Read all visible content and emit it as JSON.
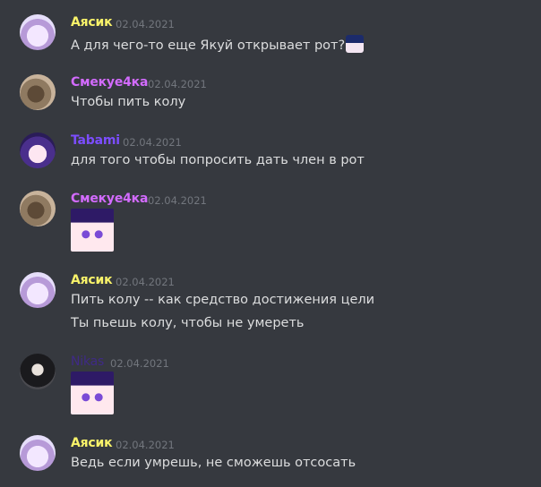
{
  "messages": [
    {
      "author": "Аясик",
      "author_color": "#f9f36a",
      "time": "02.04.2021",
      "avatar": "ayasik-avatar",
      "lines": [
        "А для чего-то еще Якуй открывает рот?"
      ],
      "emoji": "anime-face-emoji"
    },
    {
      "author": "Смекуе4ка",
      "author_color": "#d36bff",
      "time": "02.04.2021",
      "avatar": "smekue-avatar",
      "lines": [
        "Чтобы пить колу"
      ]
    },
    {
      "author": "Tabami",
      "author_color": "#7c4dff",
      "time": "02.04.2021",
      "avatar": "tabami-avatar",
      "lines": [
        "для того чтобы попросить дать член в рот"
      ]
    },
    {
      "author": "Смекуе4ка",
      "author_color": "#d36bff",
      "time": "02.04.2021",
      "avatar": "smekue-avatar",
      "sticker": "anime-girl-sticker"
    },
    {
      "author": "Аясик",
      "author_color": "#f9f36a",
      "time": "02.04.2021",
      "avatar": "ayasik-avatar",
      "lines": [
        "Пить колу -- как средство достижения цели",
        "Ты пьешь колу, чтобы не умереть"
      ]
    },
    {
      "author": "Nikas",
      "author_color": "#3f2a86",
      "time": "02.04.2021",
      "avatar": "nikas-avatar",
      "sticker": "anime-girl-laugh-sticker"
    },
    {
      "author": "Аясик",
      "author_color": "#f9f36a",
      "time": "02.04.2021",
      "avatar": "ayasik-avatar",
      "lines": [
        "Ведь если умрешь, не сможешь отсосать"
      ]
    }
  ]
}
